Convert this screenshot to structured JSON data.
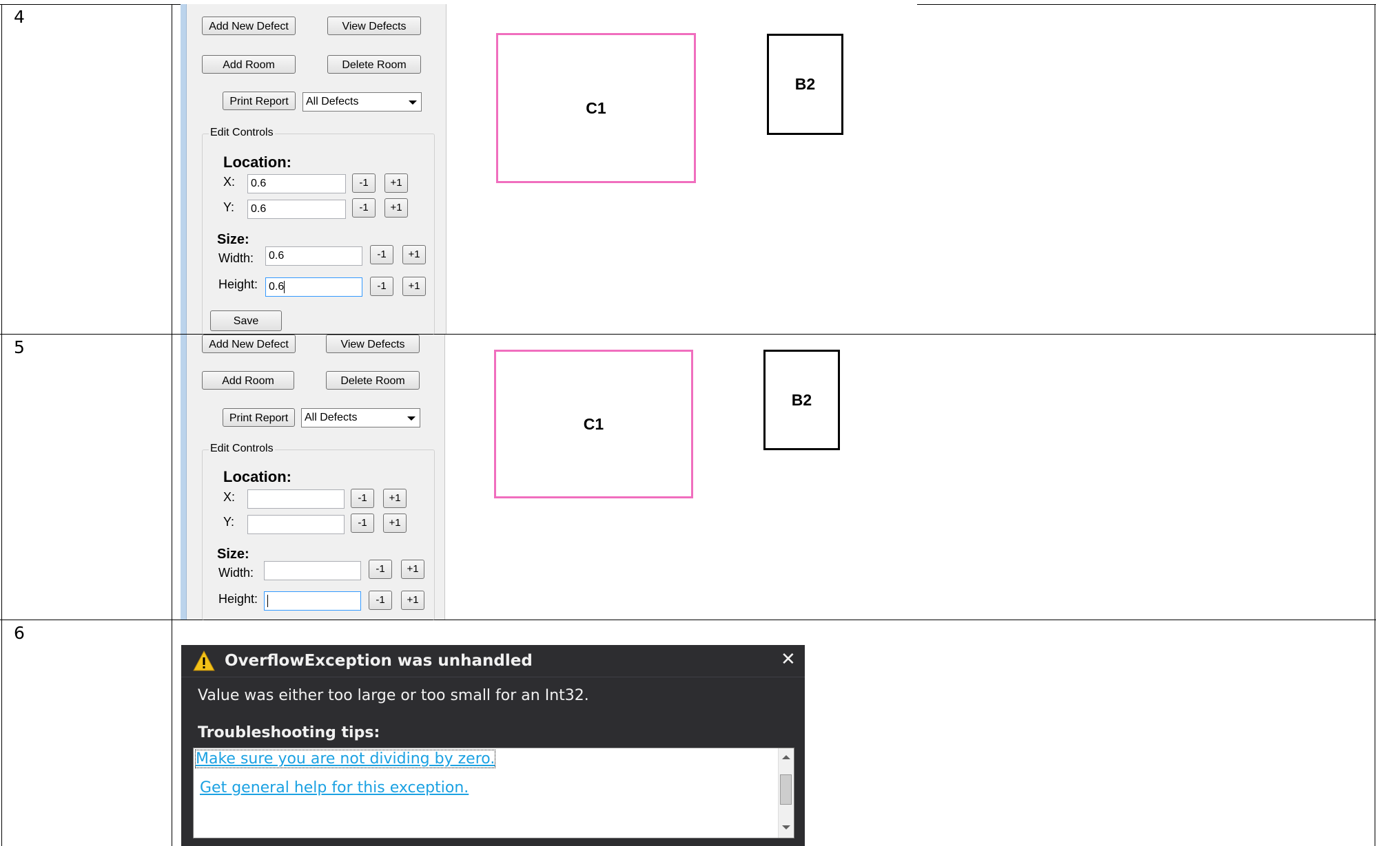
{
  "rows": [
    {
      "number": "4"
    },
    {
      "number": "5"
    },
    {
      "number": "6"
    }
  ],
  "panel": {
    "add_new_defect": "Add New Defect",
    "view_defects": "View Defects",
    "add_room": "Add Room",
    "delete_room": "Delete Room",
    "print_report": "Print Report",
    "filter_selected": "All Defects",
    "edit_controls": "Edit Controls",
    "location": "Location:",
    "x_label": "X:",
    "y_label": "Y:",
    "size": "Size:",
    "width_label": "Width:",
    "height_label": "Height:",
    "minus": "-1",
    "plus": "+1",
    "save": "Save"
  },
  "row4_values": {
    "x": "0.6",
    "y": "0.6",
    "width": "0.6",
    "height": "0.6"
  },
  "row5_values": {
    "x": "",
    "y": "",
    "width": "",
    "height": ""
  },
  "rooms": [
    {
      "label": "C1",
      "border_color": "#f06ebe"
    },
    {
      "label": "B2",
      "border_color": "#000000"
    }
  ],
  "dialog": {
    "title": "OverflowException was unhandled",
    "message": "Value was either too large or too small for an Int32.",
    "tips_heading": "Troubleshooting tips:",
    "tips": [
      "Make sure you are not dividing by zero.",
      "Get general help for this exception."
    ],
    "warning_icon": "warning-icon",
    "close_icon": "close-icon"
  }
}
